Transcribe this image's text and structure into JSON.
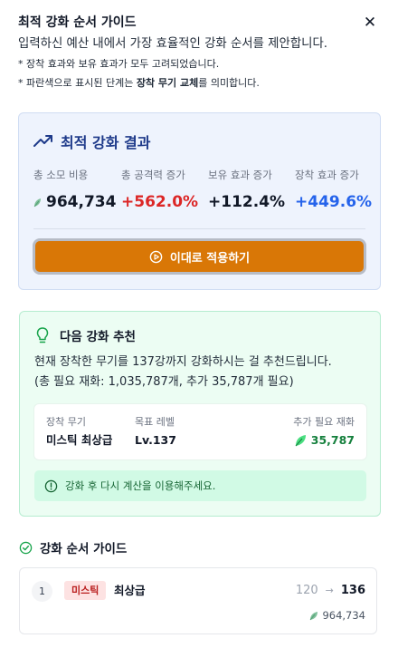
{
  "header": {
    "title": "최적 강화 순서 가이드",
    "close_icon": "close-icon"
  },
  "intro": {
    "main": "입력하신 예산 내에서 가장 효율적인 강화 순서를 제안합니다.",
    "note1": "* 장착 효과와 보유 효과가 모두 고려되었습니다.",
    "note2_prefix": "* 파란색으로 표시된 단계는 ",
    "note2_bold": "장착 무기 교체",
    "note2_suffix": "를 의미합니다."
  },
  "result": {
    "title": "최적 강화 결과",
    "icon": "trending-up-icon",
    "stats": [
      {
        "label": "총 소모 비용",
        "value": "964,734",
        "color": "#111827",
        "icon": "leaf-icon"
      },
      {
        "label": "총 공격력 증가",
        "value": "+562.0%",
        "color": "#dc2626"
      },
      {
        "label": "보유 효과 증가",
        "value": "+112.4%",
        "color": "#111827"
      },
      {
        "label": "장착 효과 증가",
        "value": "+449.6%",
        "color": "#2563eb"
      }
    ],
    "apply_label": "이대로 적용하기"
  },
  "recommend": {
    "title": "다음 강화 추천",
    "text_line1": "현재 장착한 무기를 137강까지 강화하시는 걸 추천드립니다.",
    "text_line2": "(총 필요 재화: 1,035,787개, 추가 35,787개 필요)",
    "info": {
      "weapon_label": "장착 무기",
      "weapon_value": "미스틱 최상급",
      "target_label": "목표 레벨",
      "target_value": "Lv.137",
      "extra_label": "추가 필요 재화",
      "extra_value": "35,787"
    },
    "tip": "강화 후 다시 계산을 이용해주세요."
  },
  "guide": {
    "title": "강화 순서 가이드",
    "rows": [
      {
        "step": "1",
        "tier": "미스틱",
        "grade": "최상급",
        "from": "120",
        "to": "136",
        "cost": "964,734"
      }
    ]
  },
  "colors": {
    "accent_orange": "#d97706",
    "accent_blue": "#1e3a8a",
    "green": "#15803d",
    "red": "#dc2626"
  }
}
